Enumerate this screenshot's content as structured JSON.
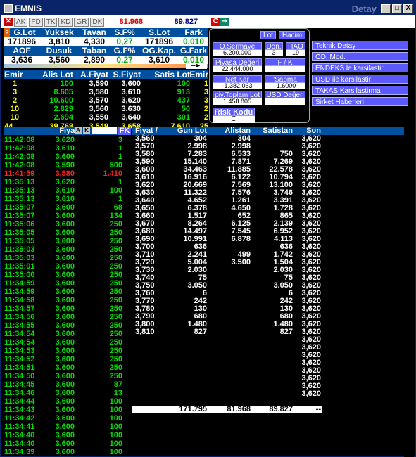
{
  "window": {
    "title": "EMNIS",
    "detail_label": "Detay",
    "btn_min": "_",
    "btn_max": "□",
    "btn_close": "X"
  },
  "toolbar": {
    "tabs": [
      "AK",
      "FD",
      "TK",
      "KD",
      "GR",
      "DK"
    ],
    "red_value": "81.968",
    "blue_value": "89.827",
    "c_label": "C",
    "arrow": "➔",
    "close": "✕"
  },
  "summary": {
    "row1_headers": [
      "G.Lot",
      "Yuksek",
      "Tavan",
      "S.F%",
      "S.Lot",
      "Fark"
    ],
    "row1_values": [
      "171896",
      "3,810",
      "4,330",
      "0,27",
      "171896",
      "0,010"
    ],
    "row2_headers": [
      "AOF",
      "Dusuk",
      "Taban",
      "G.F%",
      "OG.Kap.",
      "G.Fark"
    ],
    "row2_values": [
      "3,636",
      "3,560",
      "2,890",
      "0,27",
      "3,610",
      "0,010"
    ]
  },
  "panel": {
    "lot": "Lot",
    "hacim": "Hacim",
    "osermaye_label": "O.Sermaye",
    "osermaye_value": "6.200.000",
    "don_label": "Dön.",
    "don_value": "3",
    "hao_label": "HAO",
    "hao_value": "19",
    "piyasa_label": "Piyasa Değeri",
    "piyasa_value": "22.444.000",
    "fk_label": "F / K",
    "fk_value": "",
    "netkar_label": "Net Kar",
    "netkar_value": "-1.382.063",
    "sapma_label": "'Sapma",
    "sapma_value": "-1.6000",
    "ptoplam_label": "piy.Toplam Lot",
    "ptoplam_value": "1.458.805",
    "usd_label": "USD Değeri",
    "usd_value": "",
    "risk_label": "Risk Kodu",
    "risk_value": "C"
  },
  "right_menu": [
    "Teknik Detay",
    "OD. Mod.",
    "ENDEKS le karsilastir",
    "USD ile karsilastir",
    "TAKAS Karsilastirma",
    "Sirket Haberleri"
  ],
  "depth": {
    "headers": [
      "Emir",
      "Alis Lot",
      "A.Fiyat",
      "S.Fiyat",
      "Satis Lot",
      "Emir"
    ],
    "rows": [
      [
        "1",
        "100",
        "3,590",
        "3,600",
        "100",
        "1"
      ],
      [
        "3",
        "8.605",
        "3,580",
        "3,610",
        "913",
        "3"
      ],
      [
        "2",
        "10.600",
        "3,570",
        "3,620",
        "437",
        "3"
      ],
      [
        "10",
        "2.829",
        "3,560",
        "3,630",
        "50",
        "2"
      ],
      [
        "10",
        "2.694",
        "3,550",
        "3,640",
        "301",
        "2"
      ]
    ],
    "total": [
      "44",
      "39.768",
      "3,549",
      "3,658",
      "7.610",
      "25"
    ]
  },
  "trades": {
    "header_fiyat": "Fiyat",
    "btn_a": "A",
    "btn_k": "K",
    "header_fk": "FK",
    "rows": [
      [
        "11:42:08",
        "3,620",
        "3",
        "g"
      ],
      [
        "11:42:08",
        "3,610",
        "1",
        "g"
      ],
      [
        "11:42:08",
        "3,600",
        "1",
        "g"
      ],
      [
        "11:42:08",
        "3,590",
        "500",
        "g"
      ],
      [
        "11:41:59",
        "3,580",
        "1.410",
        "r"
      ],
      [
        "11:35:13",
        "3,620",
        "1",
        "g"
      ],
      [
        "11:35:13",
        "3,610",
        "100",
        "g"
      ],
      [
        "11:35:13",
        "3,610",
        "1",
        "g"
      ],
      [
        "11:35:07",
        "3,600",
        "68",
        "g"
      ],
      [
        "11:35:07",
        "3,600",
        "134",
        "g"
      ],
      [
        "11:35:06",
        "3,600",
        "250",
        "g"
      ],
      [
        "11:35:05",
        "3,600",
        "250",
        "g"
      ],
      [
        "11:35:05",
        "3,600",
        "250",
        "g"
      ],
      [
        "11:35:03",
        "3,600",
        "250",
        "g"
      ],
      [
        "11:35:03",
        "3,600",
        "250",
        "g"
      ],
      [
        "11:35:01",
        "3,600",
        "250",
        "g"
      ],
      [
        "11:35:00",
        "3,600",
        "250",
        "g"
      ],
      [
        "11:34:59",
        "3,600",
        "250",
        "g"
      ],
      [
        "11:34:59",
        "3,600",
        "250",
        "g"
      ],
      [
        "11:34:58",
        "3,600",
        "250",
        "g"
      ],
      [
        "11:34:57",
        "3,600",
        "250",
        "g"
      ],
      [
        "11:34:56",
        "3,600",
        "250",
        "g"
      ],
      [
        "11:34:55",
        "3,600",
        "250",
        "g"
      ],
      [
        "11:34:54",
        "3,600",
        "250",
        "g"
      ],
      [
        "11:34:54",
        "3,600",
        "250",
        "g"
      ],
      [
        "11:34:53",
        "3,600",
        "250",
        "g"
      ],
      [
        "11:34:52",
        "3,600",
        "250",
        "g"
      ],
      [
        "11:34:51",
        "3,600",
        "250",
        "g"
      ],
      [
        "11:34:50",
        "3,600",
        "250",
        "g"
      ],
      [
        "11:34:45",
        "3,600",
        "87",
        "g"
      ],
      [
        "11:34:46",
        "3,600",
        "13",
        "g"
      ],
      [
        "11:34:44",
        "3,600",
        "100",
        "g"
      ],
      [
        "11:34:43",
        "3,600",
        "100",
        "g"
      ],
      [
        "11:34:42",
        "3,600",
        "100",
        "g"
      ],
      [
        "11:34:41",
        "3,600",
        "100",
        "g"
      ],
      [
        "11:34:40",
        "3,600",
        "100",
        "g"
      ],
      [
        "11:34:40",
        "3,600",
        "100",
        "g"
      ],
      [
        "11:34:39",
        "3,600",
        "100",
        "g"
      ]
    ]
  },
  "dist": {
    "headers": [
      "Fiyat /",
      "Gun Lot",
      "Alistan",
      "Satistan",
      "Son"
    ],
    "rows": [
      [
        "3,560",
        "304",
        "304",
        "",
        "3,620"
      ],
      [
        "3,570",
        "2.998",
        "2.998",
        "",
        "3,620"
      ],
      [
        "3,580",
        "7.283",
        "6.533",
        "750",
        "3,620"
      ],
      [
        "3,590",
        "15.140",
        "7.871",
        "7.269",
        "3,620"
      ],
      [
        "3,600",
        "34.463",
        "11.885",
        "22.578",
        "3,620"
      ],
      [
        "3,610",
        "16.916",
        "6.122",
        "10.794",
        "3,620"
      ],
      [
        "3,620",
        "20.669",
        "7.569",
        "13.100",
        "3,620"
      ],
      [
        "3,630",
        "11.322",
        "7.576",
        "3.746",
        "3,620"
      ],
      [
        "3,640",
        "4.652",
        "1.261",
        "3.391",
        "3,620"
      ],
      [
        "3,650",
        "6.378",
        "4.650",
        "1.728",
        "3,620"
      ],
      [
        "3,660",
        "1.517",
        "652",
        "865",
        "3,620"
      ],
      [
        "3,670",
        "8.264",
        "6.125",
        "2.139",
        "3,620"
      ],
      [
        "3,680",
        "14.497",
        "7.545",
        "6.952",
        "3,620"
      ],
      [
        "3,690",
        "10.991",
        "6.878",
        "4.113",
        "3,620"
      ],
      [
        "3,700",
        "636",
        "",
        "636",
        "3,620"
      ],
      [
        "3,710",
        "2.241",
        "499",
        "1.742",
        "3,620"
      ],
      [
        "3,720",
        "5.004",
        "3.500",
        "1.504",
        "3,620"
      ],
      [
        "3,730",
        "2.030",
        "",
        "2.030",
        "3,620"
      ],
      [
        "3,740",
        "75",
        "",
        "75",
        "3,620"
      ],
      [
        "3,750",
        "3.050",
        "",
        "3.050",
        "3,620"
      ],
      [
        "3,760",
        "6",
        "",
        "6",
        "3,620"
      ],
      [
        "3,770",
        "242",
        "",
        "242",
        "3,620"
      ],
      [
        "3,780",
        "130",
        "",
        "130",
        "3,620"
      ],
      [
        "3,790",
        "680",
        "",
        "680",
        "3,620"
      ],
      [
        "3,800",
        "1.480",
        "",
        "1.480",
        "3,620"
      ],
      [
        "3,810",
        "827",
        "",
        "827",
        "3,620"
      ],
      [
        "",
        "",
        "",
        "",
        "3,620"
      ],
      [
        "",
        "",
        "",
        "",
        "3,620"
      ],
      [
        "",
        "",
        "",
        "",
        "3,620"
      ],
      [
        "",
        "",
        "",
        "",
        "3,620"
      ],
      [
        "",
        "",
        "",
        "",
        "3,620"
      ],
      [
        "",
        "",
        "",
        "",
        "3,620"
      ],
      [
        "",
        "",
        "",
        "",
        "3,620"
      ],
      [
        "",
        "",
        "",
        "",
        "3,620"
      ]
    ],
    "total": [
      "",
      "171.795",
      "81.968",
      "89.827",
      "--"
    ]
  }
}
